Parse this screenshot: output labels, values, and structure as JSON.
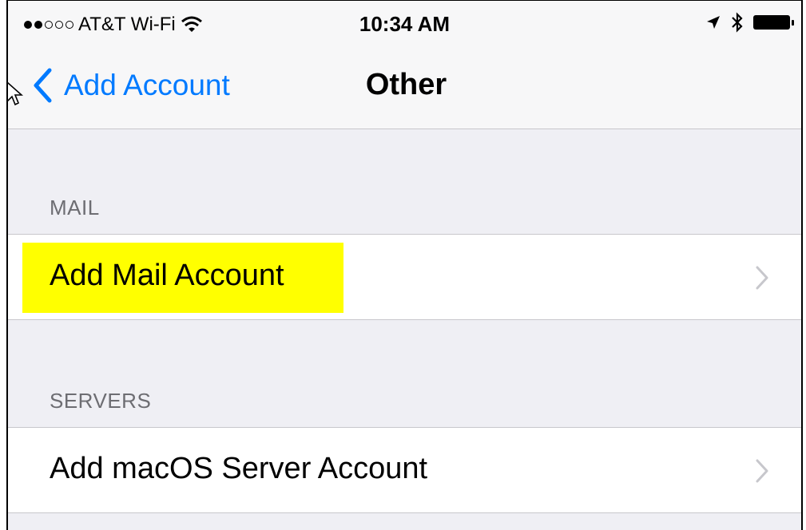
{
  "status_bar": {
    "signal_filled": 2,
    "signal_total": 5,
    "carrier": "AT&T Wi-Fi",
    "time": "10:34 AM",
    "wifi_icon": "wifi-icon",
    "location_icon": "location-arrow-icon",
    "bluetooth_icon": "bluetooth-icon",
    "battery_icon": "battery-icon"
  },
  "nav": {
    "back_label": "Add Account",
    "title": "Other"
  },
  "sections": [
    {
      "header": "MAIL",
      "items": [
        {
          "label": "Add Mail Account",
          "highlighted": true
        }
      ]
    },
    {
      "header": "SERVERS",
      "items": [
        {
          "label": "Add macOS Server Account",
          "highlighted": false
        }
      ]
    }
  ],
  "colors": {
    "accent": "#007aff",
    "highlight": "#ffff00",
    "background": "#efeff4"
  }
}
